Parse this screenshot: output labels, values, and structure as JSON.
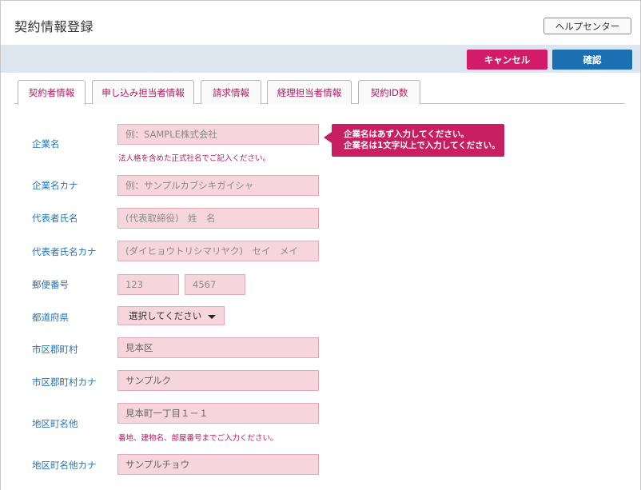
{
  "header": {
    "title": "契約情報登録",
    "help_label": "ヘルプセンター"
  },
  "actions": {
    "cancel_label": "キャンセル",
    "confirm_label": "確認"
  },
  "tabs": [
    {
      "label": "契約者情報",
      "active": true
    },
    {
      "label": "申し込み担当者情報",
      "active": false
    },
    {
      "label": "請求情報",
      "active": false
    },
    {
      "label": "経理担当者情報",
      "active": false
    },
    {
      "label": "契約ID数",
      "active": false
    }
  ],
  "form": {
    "company_name": {
      "label": "企業名",
      "placeholder": "例：SAMPLE株式会社",
      "note": "法人格を含めた正式社名でご記入ください。"
    },
    "company_kana": {
      "label": "企業名カナ",
      "placeholder": "例：サンプルカブシキガイシャ"
    },
    "rep_name": {
      "label": "代表者氏名",
      "placeholder": "(代表取締役)　姓　名"
    },
    "rep_kana": {
      "label": "代表者氏名カナ",
      "placeholder": "(ダイヒョウトリシマリヤク)　セイ　メイ"
    },
    "postal": {
      "label": "郵便番号",
      "part1": "123",
      "part2": "4567"
    },
    "prefecture": {
      "label": "都道府県",
      "selected": "選択してください"
    },
    "city": {
      "label": "市区郡町村",
      "value": "見本区"
    },
    "city_kana": {
      "label": "市区郡町村カナ",
      "value": "サンプルク"
    },
    "address": {
      "label": "地区町名他",
      "value": "見本町一丁目１－１",
      "note": "番地、建物名、部屋番号までご入力ください。"
    },
    "address_kana": {
      "label": "地区町名他カナ",
      "value": "サンプルチョウ"
    }
  },
  "tooltip": {
    "line1": "企業名はあず入力してください。",
    "line2": "企業名は1文字以上で入力してください。"
  },
  "colors": {
    "accent_pink": "#d21c6a",
    "accent_blue": "#1b6fb3",
    "label_blue": "#2873b7",
    "field_bg": "#f6d5dd"
  }
}
